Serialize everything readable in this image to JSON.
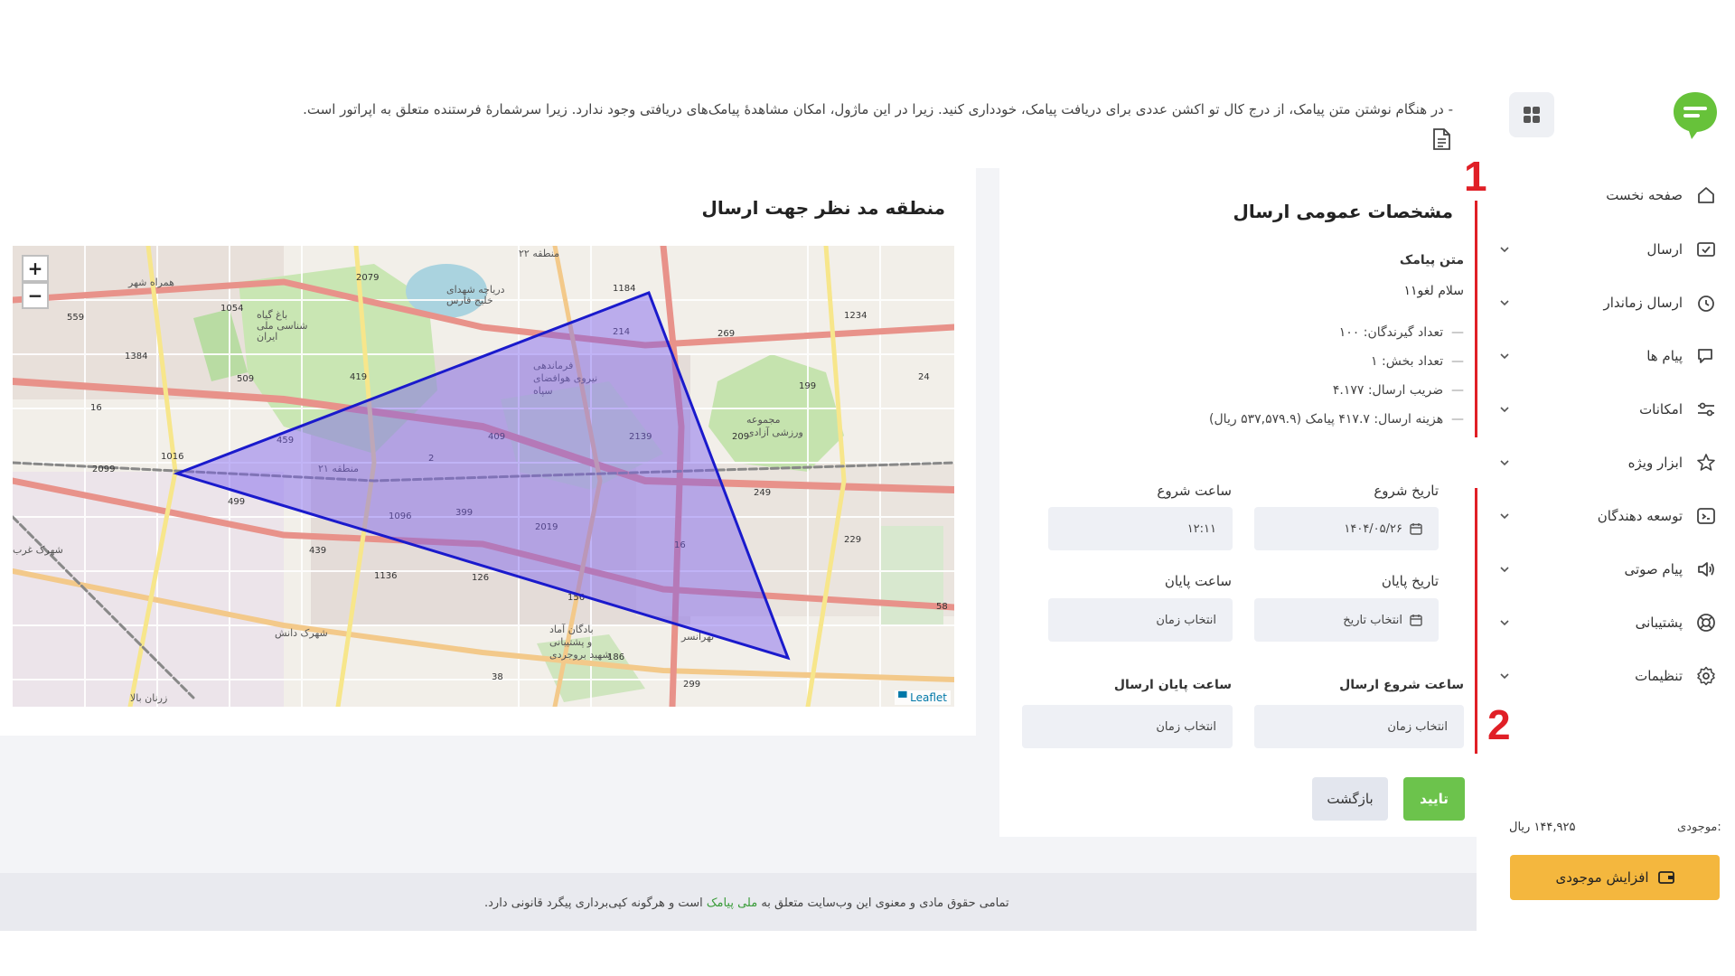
{
  "header": {
    "notice": "- در هنگام نوشتن متن پیامک، از درج کال تو اکشن عددی برای دریافت پیامک، خودداری کنید. زیرا در این ماژول، امکان مشاهدۀ پیامک‌های دریافتی وجود ندارد. زیرا سرشمارۀ فرستنده متعلق به اپراتور است."
  },
  "sidebar": {
    "items": [
      {
        "label": "صفحه نخست",
        "icon": "home-icon"
      },
      {
        "label": "ارسال",
        "icon": "send-icon"
      },
      {
        "label": "ارسال زماندار",
        "icon": "clock-icon"
      },
      {
        "label": "پیام ها",
        "icon": "chat-icon"
      },
      {
        "label": "امکانات",
        "icon": "sliders-icon"
      },
      {
        "label": "ابزار ویژه",
        "icon": "star-icon"
      },
      {
        "label": "توسعه دهندگان",
        "icon": "code-icon"
      },
      {
        "label": "پیام صوتی",
        "icon": "speaker-icon"
      },
      {
        "label": "پشتیبانی",
        "icon": "lifebuoy-icon"
      },
      {
        "label": "تنظیمات",
        "icon": "gear-icon"
      }
    ],
    "balance_label": "موجودی:",
    "balance_value": "۱۴۴,۹۲۵ ریال",
    "topup_label": "افزایش موجودی"
  },
  "general": {
    "title": "مشخصات عمومی ارسال",
    "sms_text_label": "متن پیامک",
    "sms_text_value": "سلام لغو۱۱",
    "stats": [
      "تعداد گیرندگان: ۱۰۰",
      "تعداد بخش: ۱",
      "ضریب ارسال: ۴.۱۷۷",
      "هزینه ارسال: ۴۱۷.۷ پیامک (۵۳۷,۵۷۹.۹ ریال)"
    ],
    "start_date_label": "تاریخ شروع",
    "start_date_value": "۱۴۰۴/۰۵/۲۶",
    "start_time_label": "ساعت شروع",
    "start_time_value": "۱۲:۱۱",
    "end_date_label": "تاریخ پایان",
    "end_date_placeholder": "انتخاب تاریخ",
    "end_time_label": "ساعت پایان",
    "end_time_placeholder": "انتخاب زمان",
    "send_start_time_label": "ساعت شروع ارسال",
    "send_start_time_placeholder": "انتخاب زمان",
    "send_end_time_label": "ساعت پایان ارسال",
    "send_end_time_placeholder": "انتخاب زمان",
    "confirm_label": "تایید",
    "back_label": "بازگشت"
  },
  "map": {
    "title": "منطقه مد نظر جهت ارسال",
    "zoom_in": "+",
    "zoom_out": "−",
    "attribution": "Leaflet",
    "labels": [
      "همراه شهر",
      "منطقه ۲۲",
      "منطقه ۲۱",
      "فرماندهی نیروی هوافضای سپاه",
      "مجموعه ورزشی آزادی",
      "شهرک دانش",
      "بادگان آماد و پشتیبانی شهید بروجردی",
      "دریاچه شهدای خلیج فارس",
      "باغ گیاه شناسی ملی ایران",
      "شهرک غرب",
      "زرنان بالا",
      "تهرانسر"
    ],
    "roads": [
      "2079",
      "214",
      "1184",
      "1054",
      "559",
      "1384",
      "509",
      "419",
      "269",
      "1234",
      "199",
      "24",
      "16",
      "1016",
      "2099",
      "459",
      "409",
      "2139",
      "209",
      "499",
      "2",
      "1096",
      "399",
      "2019",
      "249",
      "229",
      "439",
      "16",
      "1136",
      "126",
      "156",
      "186",
      "38",
      "299",
      "58"
    ]
  },
  "annotations": {
    "mark1": "1",
    "mark2": "2"
  },
  "footer": {
    "text_before": "تمامی حقوق مادی و معنوی این وب‌سایت متعلق به ",
    "brand": "ملی پیامک",
    "text_after": " است و هرگونه کپی‌برداری پیگرد قانونی دارد."
  },
  "colors": {
    "accent_green": "#6cc34c",
    "topup_yellow": "#f4b73e",
    "annotation_red": "#e01f26",
    "polygon_blue": "#1a1acc"
  }
}
